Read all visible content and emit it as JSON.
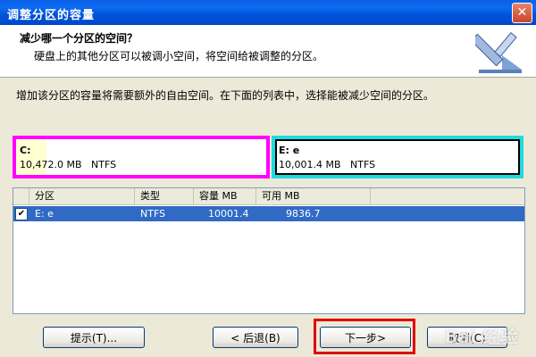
{
  "window": {
    "title": "调整分区的容量",
    "close_symbol": "✕"
  },
  "header": {
    "title": "减少哪一个分区的空间？",
    "subtitle": "硬盘上的其他分区可以被调小空间，将空间给被调整的分区。",
    "icon": "ruler-tool-icon"
  },
  "instruction": "增加该分区的容量将需要额外的自由空间。在下面的列表中，选择能被减少空间的分区。",
  "partitions_bar": [
    {
      "name": "C:",
      "size": "10,472.0 MB",
      "fs": "NTFS",
      "color": "#FF00FF"
    },
    {
      "name": "E: e",
      "size": "10,001.4 MB",
      "fs": "NTFS",
      "color": "#21DADB"
    }
  ],
  "table": {
    "columns": [
      "分区",
      "类型",
      "容量 MB",
      "可用 MB"
    ],
    "rows": [
      {
        "checked": "✔",
        "partition": "E:  e",
        "type": "NTFS",
        "capacity": "10001.4",
        "free": "9836.7"
      }
    ]
  },
  "buttons": {
    "hint": "提示(T)...",
    "back": "< 后退(B)",
    "next": "下一步>",
    "cancel": "取消(C)"
  },
  "watermark": "Bai 经验"
}
